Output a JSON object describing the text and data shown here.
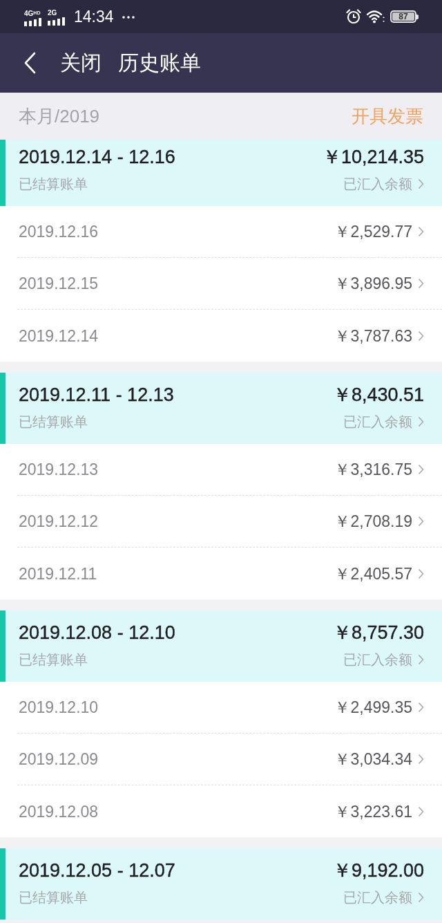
{
  "status_bar": {
    "networks": [
      {
        "label": "4G$^{HD}$"
      },
      {
        "label": "2G"
      }
    ],
    "time": "14:34",
    "battery": "87"
  },
  "header": {
    "close": "关闭",
    "title": "历史账单"
  },
  "filter_bar": {
    "period": "本月/2019",
    "action": "开具发票"
  },
  "bills": [
    {
      "range": "2019.12.14 - 12.16",
      "status": "已结算账单",
      "total": "￥10,214.35",
      "settlement": "已汇入余额",
      "days": [
        {
          "date": "2019.12.16",
          "amount": "￥2,529.77"
        },
        {
          "date": "2019.12.15",
          "amount": "￥3,896.95"
        },
        {
          "date": "2019.12.14",
          "amount": "￥3,787.63"
        }
      ]
    },
    {
      "range": "2019.12.11 - 12.13",
      "status": "已结算账单",
      "total": "￥8,430.51",
      "settlement": "已汇入余额",
      "days": [
        {
          "date": "2019.12.13",
          "amount": "￥3,316.75"
        },
        {
          "date": "2019.12.12",
          "amount": "￥2,708.19"
        },
        {
          "date": "2019.12.11",
          "amount": "￥2,405.57"
        }
      ]
    },
    {
      "range": "2019.12.08 - 12.10",
      "status": "已结算账单",
      "total": "￥8,757.30",
      "settlement": "已汇入余额",
      "days": [
        {
          "date": "2019.12.10",
          "amount": "￥2,499.35"
        },
        {
          "date": "2019.12.09",
          "amount": "￥3,034.34"
        },
        {
          "date": "2019.12.08",
          "amount": "￥3,223.61"
        }
      ]
    },
    {
      "range": "2019.12.05 - 12.07",
      "status": "已结算账单",
      "total": "￥9,192.00",
      "settlement": "已汇入余额"
    }
  ]
}
